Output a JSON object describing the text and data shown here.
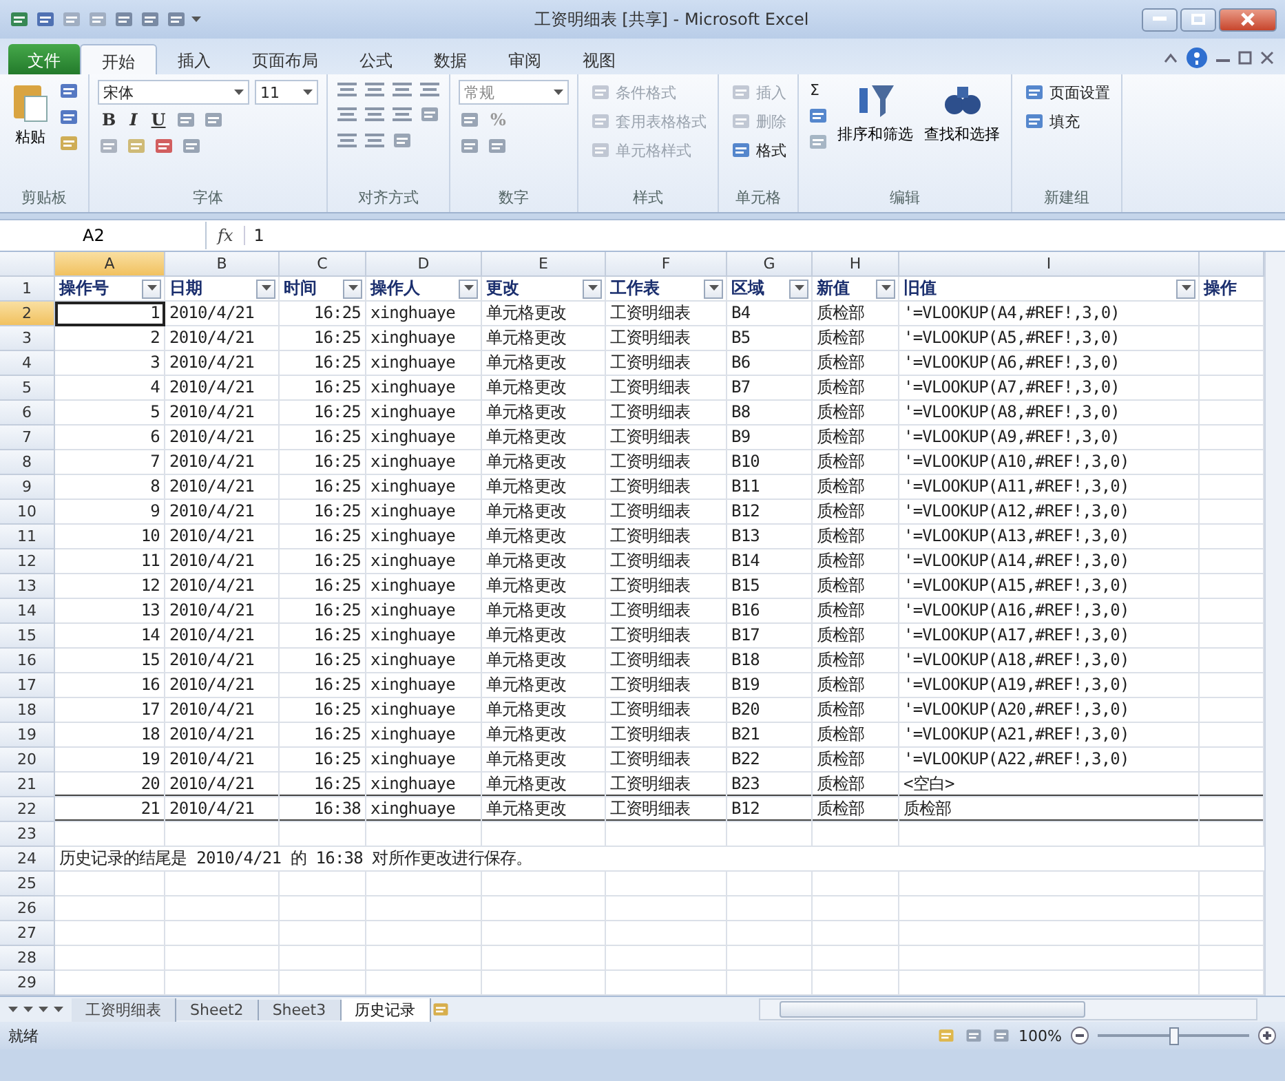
{
  "window": {
    "title": "工资明细表 [共享] - Microsoft Excel"
  },
  "ribbon_tabs": [
    {
      "label": "文件",
      "kind": "file",
      "selected": false
    },
    {
      "label": "开始",
      "kind": "tab",
      "selected": true
    },
    {
      "label": "插入",
      "kind": "tab",
      "selected": false
    },
    {
      "label": "页面布局",
      "kind": "tab",
      "selected": false
    },
    {
      "label": "公式",
      "kind": "tab",
      "selected": false
    },
    {
      "label": "数据",
      "kind": "tab",
      "selected": false
    },
    {
      "label": "审阅",
      "kind": "tab",
      "selected": false
    },
    {
      "label": "视图",
      "kind": "tab",
      "selected": false
    }
  ],
  "ribbon": {
    "groups": [
      {
        "label": "剪贴板",
        "kind": "clipboard",
        "paste": "粘贴"
      },
      {
        "label": "字体",
        "kind": "font",
        "font_name": "宋体",
        "font_size": "11",
        "buttons": [
          "B",
          "I",
          "U"
        ]
      },
      {
        "label": "对齐方式",
        "kind": "alignment"
      },
      {
        "label": "数字",
        "kind": "number",
        "format": "常规",
        "buttons": [
          "%"
        ]
      },
      {
        "label": "样式",
        "kind": "list",
        "items": [
          {
            "label": "条件格式",
            "disabled": true
          },
          {
            "label": "套用表格格式",
            "disabled": true
          },
          {
            "label": "单元格样式",
            "disabled": true
          }
        ]
      },
      {
        "label": "单元格",
        "kind": "list",
        "items": [
          {
            "label": "插入",
            "disabled": true
          },
          {
            "label": "删除",
            "disabled": true
          },
          {
            "label": "格式",
            "disabled": false
          }
        ]
      },
      {
        "label": "编辑",
        "kind": "editing",
        "sum": "Σ",
        "buttons": [
          "排序和筛选",
          "查找和选择"
        ]
      },
      {
        "label": "新建组",
        "kind": "list",
        "items": [
          {
            "label": "页面设置",
            "disabled": false
          },
          {
            "label": "填充",
            "disabled": false
          }
        ]
      }
    ]
  },
  "formula_bar": {
    "name_box": "A2",
    "fx": "fx",
    "value": "1"
  },
  "columns": [
    {
      "letter": "A",
      "selected": true,
      "kind": "number"
    },
    {
      "letter": "B",
      "selected": false,
      "kind": "number"
    },
    {
      "letter": "C",
      "selected": false,
      "kind": "number"
    },
    {
      "letter": "D",
      "selected": false,
      "kind": "text"
    },
    {
      "letter": "E",
      "selected": false,
      "kind": "text"
    },
    {
      "letter": "F",
      "selected": false,
      "kind": "text"
    },
    {
      "letter": "G",
      "selected": false,
      "kind": "text"
    },
    {
      "letter": "H",
      "selected": false,
      "kind": "text"
    },
    {
      "letter": "I",
      "selected": false,
      "kind": "text"
    },
    {
      "selected": false,
      "kind": "text"
    }
  ],
  "rows": [
    {
      "number": "1",
      "selected": false,
      "kind": "header",
      "border_below": false,
      "cells": [
        {
          "text": "操作号",
          "filter": true
        },
        {
          "text": "日期",
          "filter": true
        },
        {
          "text": "时间",
          "filter": true
        },
        {
          "text": "操作人",
          "filter": true
        },
        {
          "text": "更改",
          "filter": true
        },
        {
          "text": "工作表",
          "filter": true
        },
        {
          "text": "区域",
          "filter": true
        },
        {
          "text": "新值",
          "filter": true
        },
        {
          "text": "旧值",
          "filter": true
        },
        {
          "text": "操作",
          "filter": false
        }
      ]
    },
    {
      "number": "2",
      "selected": true,
      "kind": "data",
      "border_below": false,
      "cells": [
        "1",
        "2010/4/21",
        "16:25",
        "xinghuaye",
        "单元格更改",
        "工资明细表",
        "B4",
        "质检部",
        "'=VLOOKUP(A4,#REF!,3,0)"
      ]
    },
    {
      "number": "3",
      "selected": false,
      "kind": "data",
      "border_below": false,
      "cells": [
        "2",
        "2010/4/21",
        "16:25",
        "xinghuaye",
        "单元格更改",
        "工资明细表",
        "B5",
        "质检部",
        "'=VLOOKUP(A5,#REF!,3,0)"
      ]
    },
    {
      "number": "4",
      "selected": false,
      "kind": "data",
      "border_below": false,
      "cells": [
        "3",
        "2010/4/21",
        "16:25",
        "xinghuaye",
        "单元格更改",
        "工资明细表",
        "B6",
        "质检部",
        "'=VLOOKUP(A6,#REF!,3,0)"
      ]
    },
    {
      "number": "5",
      "selected": false,
      "kind": "data",
      "border_below": false,
      "cells": [
        "4",
        "2010/4/21",
        "16:25",
        "xinghuaye",
        "单元格更改",
        "工资明细表",
        "B7",
        "质检部",
        "'=VLOOKUP(A7,#REF!,3,0)"
      ]
    },
    {
      "number": "6",
      "selected": false,
      "kind": "data",
      "border_below": false,
      "cells": [
        "5",
        "2010/4/21",
        "16:25",
        "xinghuaye",
        "单元格更改",
        "工资明细表",
        "B8",
        "质检部",
        "'=VLOOKUP(A8,#REF!,3,0)"
      ]
    },
    {
      "number": "7",
      "selected": false,
      "kind": "data",
      "border_below": false,
      "cells": [
        "6",
        "2010/4/21",
        "16:25",
        "xinghuaye",
        "单元格更改",
        "工资明细表",
        "B9",
        "质检部",
        "'=VLOOKUP(A9,#REF!,3,0)"
      ]
    },
    {
      "number": "8",
      "selected": false,
      "kind": "data",
      "border_below": false,
      "cells": [
        "7",
        "2010/4/21",
        "16:25",
        "xinghuaye",
        "单元格更改",
        "工资明细表",
        "B10",
        "质检部",
        "'=VLOOKUP(A10,#REF!,3,0)"
      ]
    },
    {
      "number": "9",
      "selected": false,
      "kind": "data",
      "border_below": false,
      "cells": [
        "8",
        "2010/4/21",
        "16:25",
        "xinghuaye",
        "单元格更改",
        "工资明细表",
        "B11",
        "质检部",
        "'=VLOOKUP(A11,#REF!,3,0)"
      ]
    },
    {
      "number": "10",
      "selected": false,
      "kind": "data",
      "border_below": false,
      "cells": [
        "9",
        "2010/4/21",
        "16:25",
        "xinghuaye",
        "单元格更改",
        "工资明细表",
        "B12",
        "质检部",
        "'=VLOOKUP(A12,#REF!,3,0)"
      ]
    },
    {
      "number": "11",
      "selected": false,
      "kind": "data",
      "border_below": false,
      "cells": [
        "10",
        "2010/4/21",
        "16:25",
        "xinghuaye",
        "单元格更改",
        "工资明细表",
        "B13",
        "质检部",
        "'=VLOOKUP(A13,#REF!,3,0)"
      ]
    },
    {
      "number": "12",
      "selected": false,
      "kind": "data",
      "border_below": false,
      "cells": [
        "11",
        "2010/4/21",
        "16:25",
        "xinghuaye",
        "单元格更改",
        "工资明细表",
        "B14",
        "质检部",
        "'=VLOOKUP(A14,#REF!,3,0)"
      ]
    },
    {
      "number": "13",
      "selected": false,
      "kind": "data",
      "border_below": false,
      "cells": [
        "12",
        "2010/4/21",
        "16:25",
        "xinghuaye",
        "单元格更改",
        "工资明细表",
        "B15",
        "质检部",
        "'=VLOOKUP(A15,#REF!,3,0)"
      ]
    },
    {
      "number": "14",
      "selected": false,
      "kind": "data",
      "border_below": false,
      "cells": [
        "13",
        "2010/4/21",
        "16:25",
        "xinghuaye",
        "单元格更改",
        "工资明细表",
        "B16",
        "质检部",
        "'=VLOOKUP(A16,#REF!,3,0)"
      ]
    },
    {
      "number": "15",
      "selected": false,
      "kind": "data",
      "border_below": false,
      "cells": [
        "14",
        "2010/4/21",
        "16:25",
        "xinghuaye",
        "单元格更改",
        "工资明细表",
        "B17",
        "质检部",
        "'=VLOOKUP(A17,#REF!,3,0)"
      ]
    },
    {
      "number": "16",
      "selected": false,
      "kind": "data",
      "border_below": false,
      "cells": [
        "15",
        "2010/4/21",
        "16:25",
        "xinghuaye",
        "单元格更改",
        "工资明细表",
        "B18",
        "质检部",
        "'=VLOOKUP(A18,#REF!,3,0)"
      ]
    },
    {
      "number": "17",
      "selected": false,
      "kind": "data",
      "border_below": false,
      "cells": [
        "16",
        "2010/4/21",
        "16:25",
        "xinghuaye",
        "单元格更改",
        "工资明细表",
        "B19",
        "质检部",
        "'=VLOOKUP(A19,#REF!,3,0)"
      ]
    },
    {
      "number": "18",
      "selected": false,
      "kind": "data",
      "border_below": false,
      "cells": [
        "17",
        "2010/4/21",
        "16:25",
        "xinghuaye",
        "单元格更改",
        "工资明细表",
        "B20",
        "质检部",
        "'=VLOOKUP(A20,#REF!,3,0)"
      ]
    },
    {
      "number": "19",
      "selected": false,
      "kind": "data",
      "border_below": false,
      "cells": [
        "18",
        "2010/4/21",
        "16:25",
        "xinghuaye",
        "单元格更改",
        "工资明细表",
        "B21",
        "质检部",
        "'=VLOOKUP(A21,#REF!,3,0)"
      ]
    },
    {
      "number": "20",
      "selected": false,
      "kind": "data",
      "border_below": false,
      "cells": [
        "19",
        "2010/4/21",
        "16:25",
        "xinghuaye",
        "单元格更改",
        "工资明细表",
        "B22",
        "质检部",
        "'=VLOOKUP(A22,#REF!,3,0)"
      ]
    },
    {
      "number": "21",
      "selected": false,
      "kind": "data",
      "border_below": true,
      "cells": [
        "20",
        "2010/4/21",
        "16:25",
        "xinghuaye",
        "单元格更改",
        "工资明细表",
        "B23",
        "质检部",
        "<空白>"
      ]
    },
    {
      "number": "22",
      "selected": false,
      "kind": "data",
      "border_below": true,
      "cells": [
        "21",
        "2010/4/21",
        "16:38",
        "xinghuaye",
        "单元格更改",
        "工资明细表",
        "B12",
        "质检部",
        "质检部"
      ]
    },
    {
      "number": "23",
      "selected": false,
      "kind": "blank",
      "border_below": false
    },
    {
      "number": "24",
      "selected": false,
      "kind": "note",
      "border_below": false,
      "note": "历史记录的结尾是 2010/4/21 的 16:38 对所作更改进行保存。"
    },
    {
      "number": "25",
      "selected": false,
      "kind": "blank",
      "border_below": false
    },
    {
      "number": "26",
      "selected": false,
      "kind": "blank",
      "border_below": false
    },
    {
      "number": "27",
      "selected": false,
      "kind": "blank",
      "border_below": false
    },
    {
      "number": "28",
      "selected": false,
      "kind": "blank",
      "border_below": false
    },
    {
      "number": "29",
      "selected": false,
      "kind": "blank",
      "border_below": false
    }
  ],
  "sheet_tabs": [
    {
      "label": "工资明细表",
      "selected": false
    },
    {
      "label": "Sheet2",
      "selected": false
    },
    {
      "label": "Sheet3",
      "selected": false
    },
    {
      "label": "历史记录",
      "selected": true
    }
  ],
  "status_bar": {
    "status": "就绪",
    "zoom": "100%",
    "zoom_slider": {
      "level": 0.5
    }
  }
}
